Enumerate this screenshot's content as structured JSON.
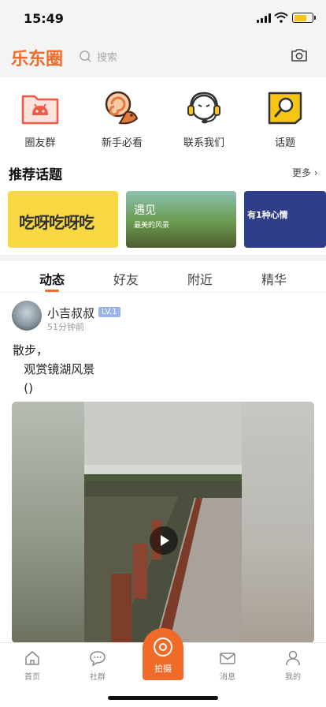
{
  "status_bar": {
    "time": "15:49"
  },
  "header": {
    "logo": "乐东圈",
    "search_placeholder": "搜索",
    "camera_icon": "camera-icon"
  },
  "quick_entries": [
    {
      "label": "圈友群",
      "icon": "folder-android-icon",
      "color": "#ef5a48"
    },
    {
      "label": "新手必看",
      "icon": "snail-icon",
      "color": "#e0793b"
    },
    {
      "label": "联系我们",
      "icon": "headset-icon",
      "color": "#f5c518"
    },
    {
      "label": "话题",
      "icon": "topic-search-icon",
      "color": "#f5c518"
    }
  ],
  "recommended": {
    "title": "推荐话题",
    "more": "更多 ›",
    "banners": [
      {
        "text": "吃呀吃呀吃"
      },
      {
        "title": "遇见",
        "subtitle": "最美的风景"
      },
      {
        "text": "有1种心情"
      }
    ]
  },
  "tabs": [
    {
      "label": "动态",
      "active": true
    },
    {
      "label": "好友",
      "active": false
    },
    {
      "label": "附近",
      "active": false
    },
    {
      "label": "精华",
      "active": false
    }
  ],
  "post": {
    "username": "小吉叔叔",
    "level": "LV.1",
    "time": "51分钟前",
    "text": "散步，\n   观赏镜湖风景\n   ()"
  },
  "bottom_nav": [
    {
      "label": "首页",
      "icon": "home-icon"
    },
    {
      "label": "社群",
      "icon": "chat-bubble-icon"
    },
    {
      "label": "拍摄",
      "icon": "shoot-icon"
    },
    {
      "label": "消息",
      "icon": "mail-icon"
    },
    {
      "label": "我的",
      "icon": "person-icon"
    }
  ],
  "colors": {
    "accent": "#f06a2a",
    "level_badge": "#9bb4e8"
  }
}
